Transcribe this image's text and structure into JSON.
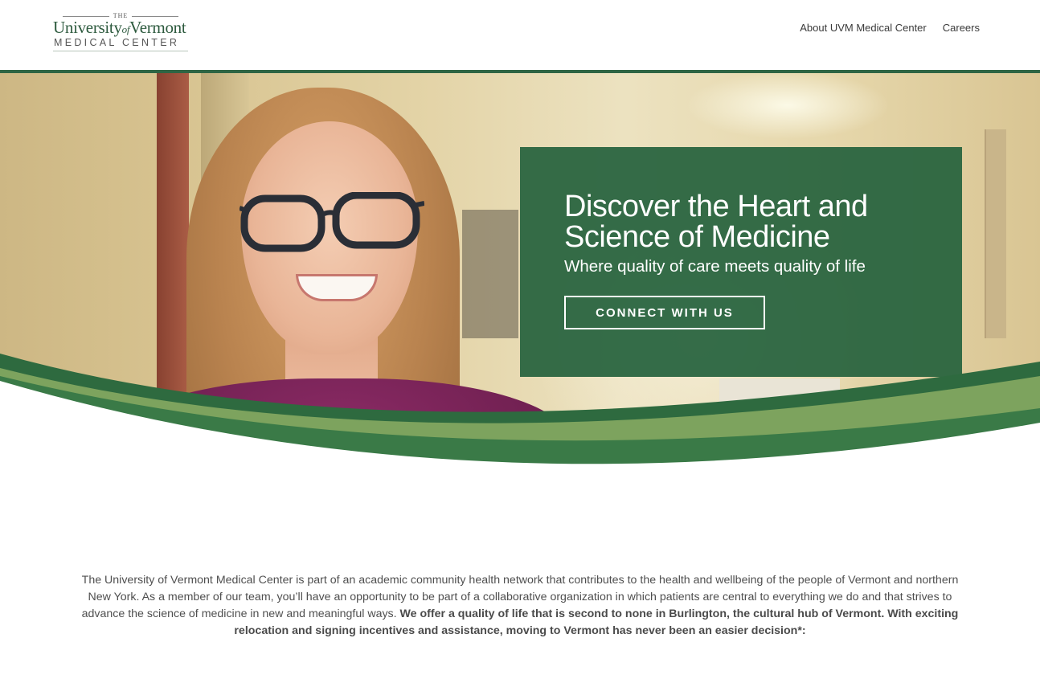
{
  "header": {
    "logo": {
      "the": "THE",
      "name_part1": "University",
      "name_of": "of",
      "name_part2": "Vermont",
      "subline": "MEDICAL CENTER"
    },
    "nav": [
      {
        "label": "About UVM Medical Center"
      },
      {
        "label": "Careers"
      }
    ]
  },
  "hero": {
    "title": "Discover the Heart and Science of Medicine",
    "subtitle": "Where quality of care meets quality of life",
    "cta_label": "CONNECT WITH US"
  },
  "intro": {
    "text": "The University of Vermont Medical Center is part of an academic community health network that contributes to the health and wellbeing of the people of Vermont and northern New York. As a member of our team, you’ll have an opportunity to be part of a collaborative organization in which patients are central to everything we do and that strives to advance the science of medicine in new and meaningful ways. ",
    "bold_text": "We offer a quality of life that is second to none in Burlington, the cultural hub of Vermont. With exciting relocation and signing incentives and assistance, moving to Vermont has never been an easier decision*:"
  },
  "colors": {
    "brand_green": "#2e6544",
    "callout_green": "#26623d",
    "swoosh_light": "#7da35e",
    "swoosh_dark": "#2e6a3f"
  }
}
